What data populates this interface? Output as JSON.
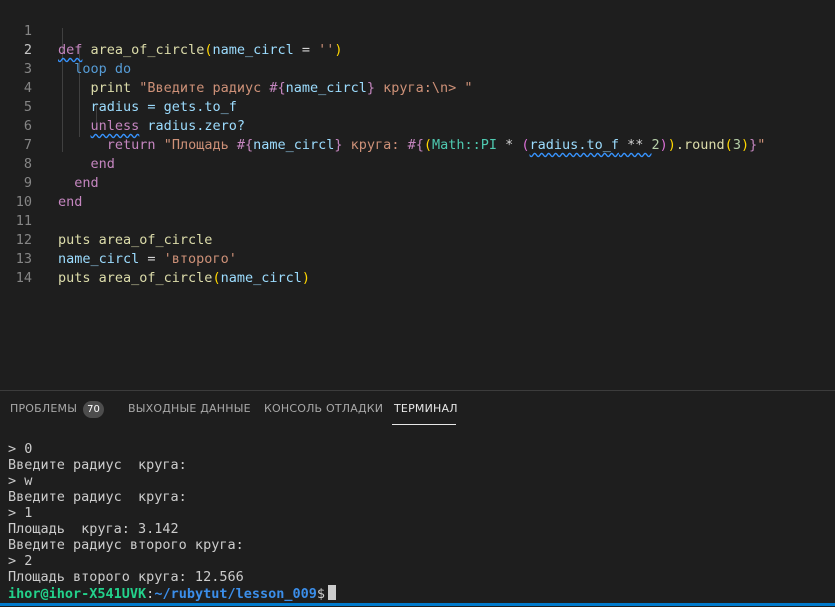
{
  "editor": {
    "line_numbers": [
      "1",
      "2",
      "3",
      "4",
      "5",
      "6",
      "7",
      "8",
      "9",
      "10",
      "11",
      "12",
      "13",
      "14"
    ],
    "active_line": "2",
    "code": {
      "l1": {
        "kw_def": "def",
        "fn": "area_of_circle",
        "open": "(",
        "param": "name_circl",
        "eq": " = ",
        "str": "''",
        "close": ")"
      },
      "l2": {
        "kw": "loop do"
      },
      "l3": {
        "fn": "print",
        "str1": "\"Введите радиус ",
        "interp_open": "#{",
        "var": "name_circl",
        "interp_close": "}",
        "str2": " круга:\\n> \""
      },
      "l4": {
        "var": "radius",
        "rest": " = gets.to_f"
      },
      "l5": {
        "kw": "unless",
        "rest": " radius.zero?"
      },
      "l6": {
        "kw": "return",
        "str1": "\"Площадь ",
        "i1_open": "#{",
        "var1": "name_circl",
        "i1_close": "}",
        "str2": " круга: ",
        "i2_open": "#{",
        "paren1": "(",
        "const": "Math::PI",
        "op": " * ",
        "paren2": "(",
        "var2": "radius.to_f",
        "pow": " ** ",
        "num": "2",
        "paren3": ")",
        "paren4": ")",
        ".round": ".round",
        "paren5": "(",
        "num2": "3",
        "paren6": ")",
        "i2_close": "}",
        "str3": "\""
      },
      "l7": {
        "kw": "end"
      },
      "l8": {
        "kw": "end"
      },
      "l9": {
        "kw": "end"
      },
      "l11": {
        "fn": "puts",
        "rest": " area_of_circle"
      },
      "l12": {
        "var": "name_circl",
        "eq": " = ",
        "str": "'второго'"
      },
      "l13": {
        "fn": "puts",
        "fn2": " area_of_circle",
        "open": "(",
        "var": "name_circl",
        "close": ")"
      }
    }
  },
  "panel": {
    "tabs": [
      {
        "label": "ПРОБЛЕМЫ"
      },
      {
        "label": "ВЫХОДНЫЕ ДАННЫЕ"
      },
      {
        "label": "КОНСОЛЬ ОТЛАДКИ"
      },
      {
        "label": "ТЕРМИНАЛ"
      }
    ],
    "problems_count": "70",
    "active_tab": "ТЕРМИНАЛ"
  },
  "terminal": {
    "lines": [
      "> 0",
      "Введите радиус  круга:",
      "> w",
      "Введите радиус  круга:",
      "> 1",
      "Площадь  круга: 3.142",
      "Введите радиус второго круга:",
      "> 2",
      "Площадь второго круга: 12.566"
    ],
    "prompt_user": "ihor@ihor-X541UVK",
    "prompt_sep": ":",
    "prompt_path": "~/rubytut/lesson_009",
    "prompt_symbol": "$"
  },
  "colors": {
    "background": "#1e1e1e",
    "accent": "#007acc",
    "keyword": "#c586c0",
    "string": "#ce9178",
    "variable": "#9cdcfe"
  }
}
